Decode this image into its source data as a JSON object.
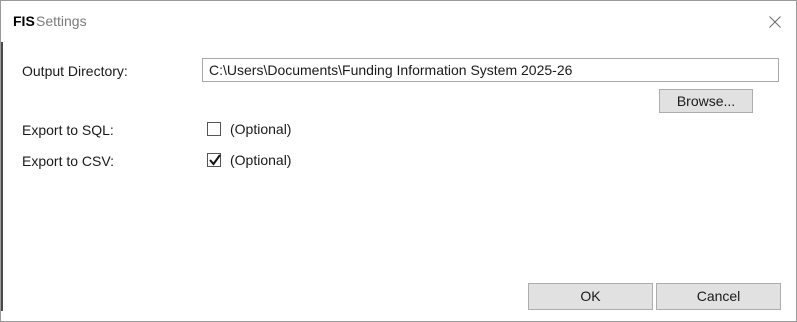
{
  "window": {
    "app_logo": "FIS",
    "title": "Settings"
  },
  "form": {
    "output_directory_label": "Output Directory:",
    "output_directory_value": "C:\\Users\\Documents\\Funding Information System 2025-26",
    "browse_label": "Browse...",
    "export_sql_label": "Export to SQL:",
    "export_sql_checked": false,
    "export_sql_hint": "(Optional)",
    "export_csv_label": "Export to CSV:",
    "export_csv_checked": true,
    "export_csv_hint": "(Optional)"
  },
  "footer": {
    "ok_label": "OK",
    "cancel_label": "Cancel"
  },
  "icons": {
    "close": "close-icon",
    "checkmark": "checkmark-icon"
  }
}
